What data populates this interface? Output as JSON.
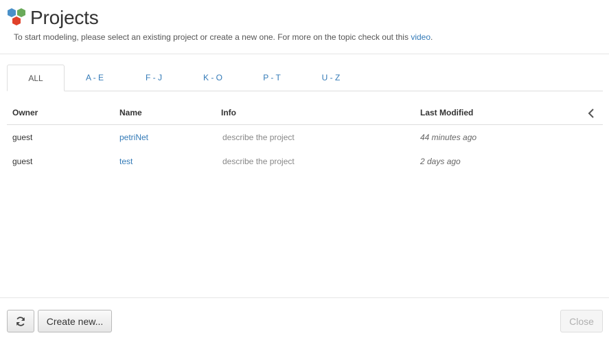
{
  "header": {
    "title": "Projects",
    "subtitle_text": "To start modeling, please select an existing project or create a new one. For more on the topic check out this ",
    "subtitle_link": "video",
    "subtitle_end": "."
  },
  "tabs": [
    {
      "label": "ALL",
      "active": true
    },
    {
      "label": "A - E",
      "active": false
    },
    {
      "label": "F - J",
      "active": false
    },
    {
      "label": "K - O",
      "active": false
    },
    {
      "label": "P - T",
      "active": false
    },
    {
      "label": "U - Z",
      "active": false
    }
  ],
  "table": {
    "columns": [
      "Owner",
      "Name",
      "Info",
      "Last Modified"
    ],
    "rows": [
      {
        "owner": "guest",
        "name": "petriNet",
        "info": "describe the project",
        "modified": "44 minutes ago"
      },
      {
        "owner": "guest",
        "name": "test",
        "info": "describe the project",
        "modified": "2 days ago"
      }
    ]
  },
  "footer": {
    "refresh_icon": "refresh-icon",
    "create_label": "Create new...",
    "close_label": "Close"
  },
  "colors": {
    "link": "#337ab7",
    "logo_blue": "#4a90c8",
    "logo_green": "#6aaa5a",
    "logo_red": "#e0412a"
  }
}
